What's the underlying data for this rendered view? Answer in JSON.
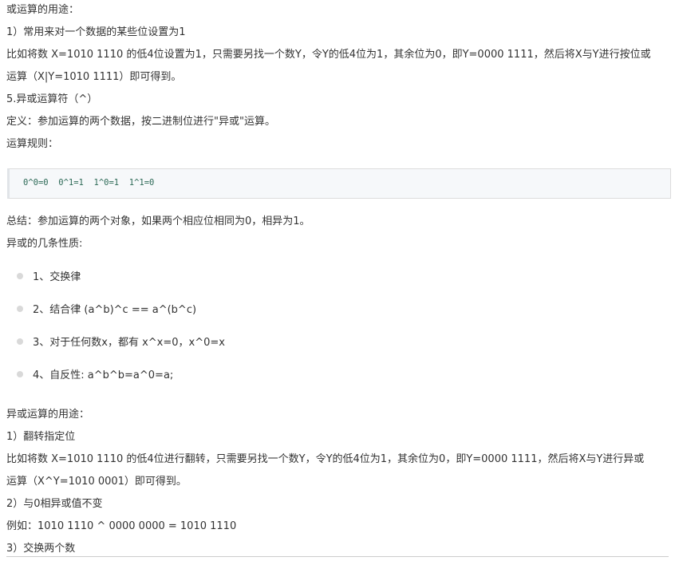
{
  "section1": {
    "title": "或运算的用途：",
    "item1": "1）常用来对一个数据的某些位设置为1",
    "desc_line1": "比如将数 X=1010 1110 的低4位设置为1，只需要另找一个数Y，令Y的低4位为1，其余位为0，即Y=0000 1111，然后将X与Y进行按位或",
    "desc_line2": "运算（X|Y=1010 1111）即可得到。"
  },
  "xor": {
    "heading": "5.异或运算符（^）",
    "definition": "定义：参加运算的两个数据，按二进制位进行\"异或\"运算。",
    "rules_label": "运算规则：",
    "code": "0^0=0  0^1=1  1^0=1  1^1=0",
    "summary": "总结：参加运算的两个对象，如果两个相应位相同为0，相异为1。",
    "properties_title": "异或的几条性质:",
    "properties": [
      "1、交换律",
      "2、结合律 (a^b)^c == a^(b^c)",
      "3、对于任何数x，都有 x^x=0，x^0=x",
      "4、自反性: a^b^b=a^0=a;"
    ]
  },
  "section2": {
    "title": "异或运算的用途：",
    "item1": "1）翻转指定位",
    "desc_line1": "比如将数 X=1010 1110 的低4位进行翻转，只需要另找一个数Y，令Y的低4位为1，其余位为0，即Y=0000 1111，然后将X与Y进行异或",
    "desc_line2": "运算（X^Y=1010 0001）即可得到。",
    "item2": "2）与0相异或值不变",
    "example": "例如：1010 1110 ^ 0000 0000 = 1010 1110",
    "item3": "3）交换两个数"
  }
}
